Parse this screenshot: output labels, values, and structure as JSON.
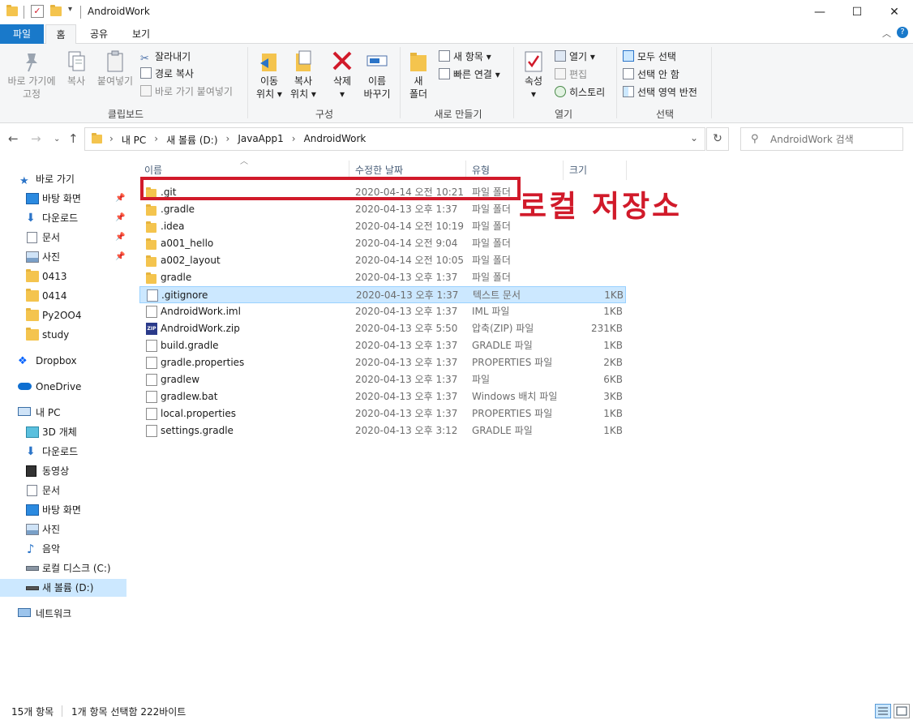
{
  "window": {
    "title": "AndroidWork",
    "minimize": "—",
    "maximize": "☐",
    "close": "✕"
  },
  "tabs": {
    "file": "파일",
    "home": "홈",
    "share": "공유",
    "view": "보기"
  },
  "ribbon": {
    "clipboard": {
      "label": "클립보드",
      "pin": [
        "바로 가기에",
        "고정"
      ],
      "copy": "복사",
      "paste": "붙여넣기",
      "cut": "잘라내기",
      "copy_path": "경로 복사",
      "paste_shortcut": "바로 가기 붙여넣기"
    },
    "organize": {
      "label": "구성",
      "move_to": [
        "이동",
        "위치 ▾"
      ],
      "copy_to": [
        "복사",
        "위치 ▾"
      ],
      "delete": [
        "삭제",
        "▾"
      ],
      "rename": [
        "이름",
        "바꾸기"
      ]
    },
    "new": {
      "label": "새로 만들기",
      "new_folder": [
        "새",
        "폴더"
      ],
      "new_item": "새 항목 ▾",
      "easy_access": "빠른 연결 ▾"
    },
    "open": {
      "label": "열기",
      "properties": [
        "속성",
        "▾"
      ],
      "open": "열기 ▾",
      "edit": "편집",
      "history": "히스토리"
    },
    "select": {
      "label": "선택",
      "select_all": "모두 선택",
      "select_none": "선택 안 함",
      "invert": "선택 영역 반전"
    }
  },
  "address": {
    "crumbs": [
      "내 PC",
      "새 볼륨 (D:)",
      "JavaApp1",
      "AndroidWork"
    ],
    "search_placeholder": "AndroidWork 검색"
  },
  "nav": {
    "quick_access": "바로 가기",
    "quick_items": [
      "바탕 화면",
      "다운로드",
      "문서",
      "사진",
      "0413",
      "0414",
      "Py2OO4",
      "study"
    ],
    "dropbox": "Dropbox",
    "onedrive": "OneDrive",
    "this_pc": "내 PC",
    "pc_items": [
      "3D 개체",
      "다운로드",
      "동영상",
      "문서",
      "바탕 화면",
      "사진",
      "음악",
      "로컬 디스크 (C:)",
      "새 볼륨 (D:)"
    ],
    "network": "네트워크"
  },
  "columns": {
    "name": "이름",
    "date": "수정한 날짜",
    "type": "유형",
    "size": "크기"
  },
  "files": [
    {
      "name": ".git",
      "date": "2020-04-14 오전 10:21",
      "type": "파일 폴더",
      "size": "",
      "icon": "folder"
    },
    {
      "name": ".gradle",
      "date": "2020-04-13 오후 1:37",
      "type": "파일 폴더",
      "size": "",
      "icon": "folder"
    },
    {
      "name": ".idea",
      "date": "2020-04-14 오전 10:19",
      "type": "파일 폴더",
      "size": "",
      "icon": "folder"
    },
    {
      "name": "a001_hello",
      "date": "2020-04-14 오전 9:04",
      "type": "파일 폴더",
      "size": "",
      "icon": "folder"
    },
    {
      "name": "a002_layout",
      "date": "2020-04-14 오전 10:05",
      "type": "파일 폴더",
      "size": "",
      "icon": "folder"
    },
    {
      "name": "gradle",
      "date": "2020-04-13 오후 1:37",
      "type": "파일 폴더",
      "size": "",
      "icon": "folder"
    },
    {
      "name": ".gitignore",
      "date": "2020-04-13 오후 1:37",
      "type": "텍스트 문서",
      "size": "1KB",
      "icon": "text"
    },
    {
      "name": "AndroidWork.iml",
      "date": "2020-04-13 오후 1:37",
      "type": "IML 파일",
      "size": "1KB",
      "icon": "file"
    },
    {
      "name": "AndroidWork.zip",
      "date": "2020-04-13 오후 5:50",
      "type": "압축(ZIP) 파일",
      "size": "231KB",
      "icon": "zip"
    },
    {
      "name": "build.gradle",
      "date": "2020-04-13 오후 1:37",
      "type": "GRADLE 파일",
      "size": "1KB",
      "icon": "file"
    },
    {
      "name": "gradle.properties",
      "date": "2020-04-13 오후 1:37",
      "type": "PROPERTIES 파일",
      "size": "2KB",
      "icon": "file"
    },
    {
      "name": "gradlew",
      "date": "2020-04-13 오후 1:37",
      "type": "파일",
      "size": "6KB",
      "icon": "file"
    },
    {
      "name": "gradlew.bat",
      "date": "2020-04-13 오후 1:37",
      "type": "Windows 배치 파일",
      "size": "3KB",
      "icon": "bat"
    },
    {
      "name": "local.properties",
      "date": "2020-04-13 오후 1:37",
      "type": "PROPERTIES 파일",
      "size": "1KB",
      "icon": "file"
    },
    {
      "name": "settings.gradle",
      "date": "2020-04-13 오후 3:12",
      "type": "GRADLE 파일",
      "size": "1KB",
      "icon": "file"
    }
  ],
  "selected_index": 6,
  "annotation": "로컬 저장소",
  "status": {
    "count": "15개 항목",
    "selection": "1개 항목 선택함 222바이트"
  },
  "colors": {
    "accent": "#1979ca",
    "annotation": "#d11a2a",
    "folder": "#f4c44e",
    "selection": "#cce8ff"
  }
}
